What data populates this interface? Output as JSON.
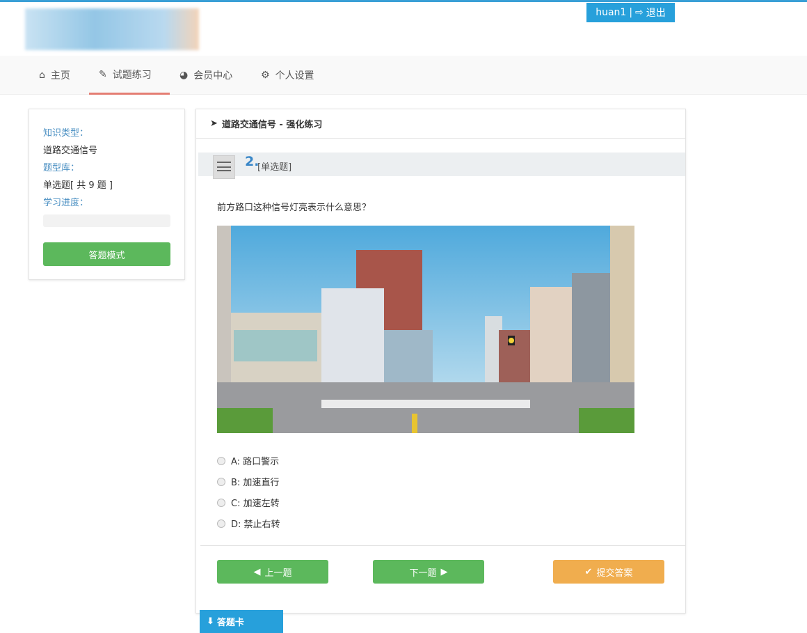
{
  "header": {
    "username": "huan1",
    "logout": "退出"
  },
  "nav": [
    {
      "label": "主页",
      "icon": "home-icon"
    },
    {
      "label": "试题练习",
      "icon": "edit-icon"
    },
    {
      "label": "会员中心",
      "icon": "dashboard-icon"
    },
    {
      "label": "个人设置",
      "icon": "gears-icon"
    }
  ],
  "sidebar": {
    "knowledge_label": "知识类型：",
    "knowledge_value": "道路交通信号",
    "bank_label": "题型库：",
    "bank_value": "单选题[ 共 9 题 ]",
    "progress_label": "学习进度：",
    "progress": 0,
    "mode_button": "答题模式"
  },
  "main": {
    "title": "道路交通信号 - 强化练习",
    "question_number": "2.",
    "question_type": "[单选题]",
    "question": "前方路口这种信号灯亮表示什么意思？",
    "options": [
      "A: 路口警示",
      "B: 加速直行",
      "C: 加速左转",
      "D: 禁止右转"
    ],
    "prev": "上一题",
    "next": "下一题",
    "submit": "提交答案"
  },
  "answer_card": "答题卡"
}
